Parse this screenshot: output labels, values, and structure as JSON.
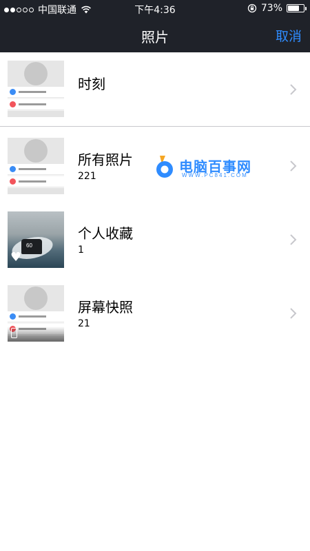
{
  "status_bar": {
    "carrier": "中国联通",
    "time": "下午4:36",
    "battery_percent": "73%",
    "battery_level": 0.73,
    "signal_bars_filled": 2,
    "signal_bars_total": 5
  },
  "nav": {
    "title": "照片",
    "cancel_label": "取消",
    "accent_color": "#2f8cff"
  },
  "albums": [
    {
      "title": "时刻",
      "count": ""
    },
    {
      "title": "所有照片",
      "count": "221"
    },
    {
      "title": "个人收藏",
      "count": "1"
    },
    {
      "title": "屏幕快照",
      "count": "21"
    }
  ],
  "watermark": {
    "name": "电脑百事网",
    "url": "WWW.PC841.COM"
  }
}
